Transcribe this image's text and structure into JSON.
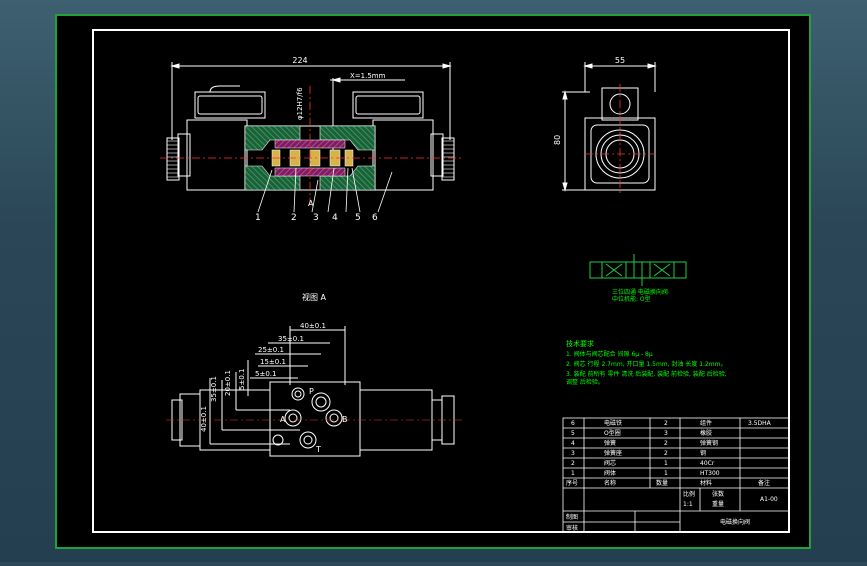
{
  "colors": {
    "background": "#000000",
    "frame_outer": "#22a13a",
    "frame_inner": "#ffffff",
    "dimension": "#ffffff",
    "body_line": "#ffffff",
    "hatch_section": "#c0399a",
    "hatch_body": "#2e8b57",
    "spool": "#d6b24a",
    "note_text": "#00ff00",
    "center_line": "#ff3030",
    "table_line": "#ffffff"
  },
  "front_view": {
    "overall_width_dim": "224",
    "stroke_dim": "X=1.5mm",
    "fit_dim": "φ12H7/f6",
    "callouts": [
      "1",
      "2",
      "A",
      "3",
      "4",
      "5",
      "6"
    ]
  },
  "side_view": {
    "width_dim": "55",
    "height_dim": "80"
  },
  "view_a": {
    "title": "视图 A",
    "dims_horizontal": [
      "40±0.1",
      "35±0.1",
      "25±0.1",
      "15±0.1",
      "5±0.1"
    ],
    "dims_vertical": [
      "35±0.1",
      "20±0.1",
      "5±0.1"
    ],
    "width_dim": "40±0.1",
    "port_labels": [
      "P",
      "A",
      "B",
      "T"
    ]
  },
  "symbol": {
    "caption_1": "三位四通 电磁换向阀",
    "caption_2": "中位机能: O型"
  },
  "tech_notes": {
    "title": "技术要求",
    "lines": [
      "1. 阀体与阀芯配合 间隙 6μ - 8μ",
      "2. 阀芯 行程 2.7mm, 开口量 1.5mm,  封油 长度 1.2mm。",
      "3. 装配 前所有 零件 清洗 后装配, 装配 前检验, 装配 后检验,",
      "   调整 后检验。"
    ]
  },
  "parts_table": {
    "rows": [
      {
        "no": "6",
        "name": "电磁铁",
        "qty": "2",
        "material": "组件",
        "note": "3.5DHA"
      },
      {
        "no": "5",
        "name": "O型圈",
        "qty": "3",
        "material": "橡胶",
        "note": ""
      },
      {
        "no": "4",
        "name": "弹簧",
        "qty": "2",
        "material": "弹簧钢",
        "note": ""
      },
      {
        "no": "3",
        "name": "弹簧座",
        "qty": "2",
        "material": "钢",
        "note": ""
      },
      {
        "no": "2",
        "name": "阀芯",
        "qty": "1",
        "material": "40Cr",
        "note": ""
      },
      {
        "no": "1",
        "name": "阀体",
        "qty": "1",
        "material": "HT300",
        "note": ""
      }
    ],
    "header": [
      "序号",
      "名称",
      "数量",
      "材料",
      "备注"
    ]
  },
  "title_block": {
    "scale_label": "比例",
    "scale_value": "1:1",
    "sheet_label": "张数",
    "weight_label": "重量",
    "drawing_no": "A1-00",
    "drawn_by": "制图",
    "checked_by": "审核",
    "title": "电磁换向阀"
  }
}
